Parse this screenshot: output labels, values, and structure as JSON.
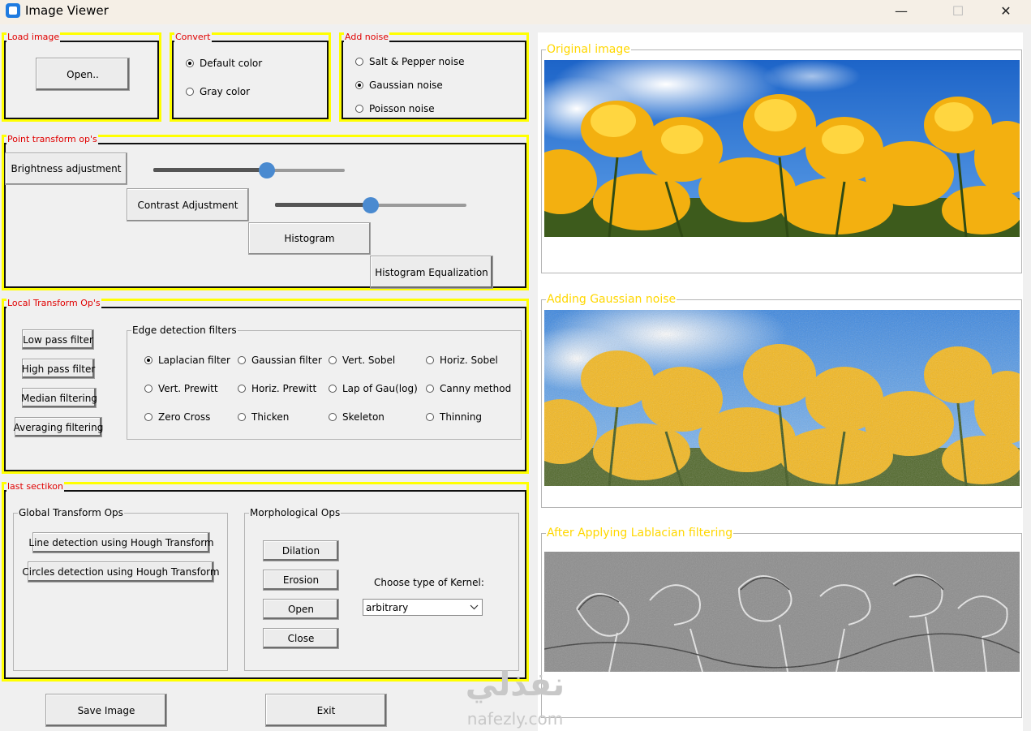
{
  "window": {
    "title": "Image Viewer",
    "minimize": "—",
    "maximize": "☐",
    "close": "✕"
  },
  "load": {
    "label": "Load image",
    "open": "Open.."
  },
  "convert": {
    "label": "Convert",
    "options": [
      "Default color",
      "Gray color"
    ],
    "selected": 0
  },
  "noise": {
    "label": "Add noise",
    "options": [
      "Salt & Pepper noise",
      "Gaussian noise",
      "Poisson noise"
    ],
    "selected": 1
  },
  "point": {
    "label": "Point transform op's",
    "brightness": "Brightness adjustment",
    "contrast": "Contrast Adjustment",
    "histogram": "Histogram",
    "equalization": "Histogram Equalization",
    "brightness_value": 0.6,
    "contrast_value": 0.5
  },
  "local": {
    "label": "Local Transform Op's",
    "buttons": [
      "Low pass filter",
      "High pass filter",
      "Median filtering",
      "Averaging filtering"
    ],
    "edge_label": "Edge detection filters",
    "edge_options": [
      "Laplacian filter",
      "Gaussian filter",
      "Vert. Sobel",
      "Horiz. Sobel",
      "Vert. Prewitt",
      "Horiz. Prewitt",
      "Lap of Gau(log)",
      "Canny method",
      "Zero Cross",
      "Thicken",
      "Skeleton",
      "Thinning"
    ],
    "edge_selected": 0
  },
  "last": {
    "label": "last sectikon",
    "global_label": "Global Transform Ops",
    "line_detect": "Line detection using Hough Transform",
    "circle_detect": "Circles detection using Hough Transform",
    "morph_label": "Morphological Ops",
    "dilation": "Dilation",
    "erosion": "Erosion",
    "open": "Open",
    "close": "Close",
    "kernel_label": "Choose type of Kernel:",
    "kernel_value": "arbitrary"
  },
  "bottom": {
    "save": "Save Image",
    "exit": "Exit"
  },
  "right": {
    "original": "Original image",
    "noisy": "Adding Gaussian noise",
    "filtered": "After Applying Lablacian filtering"
  },
  "watermark": {
    "arabic": "نفذلي",
    "latin": "nafezly.com"
  },
  "colors": {
    "yellow_border": "#ffff00",
    "red_label": "#e00000",
    "gold_label": "#ffd700",
    "slider_knob": "#4a8ad0"
  }
}
